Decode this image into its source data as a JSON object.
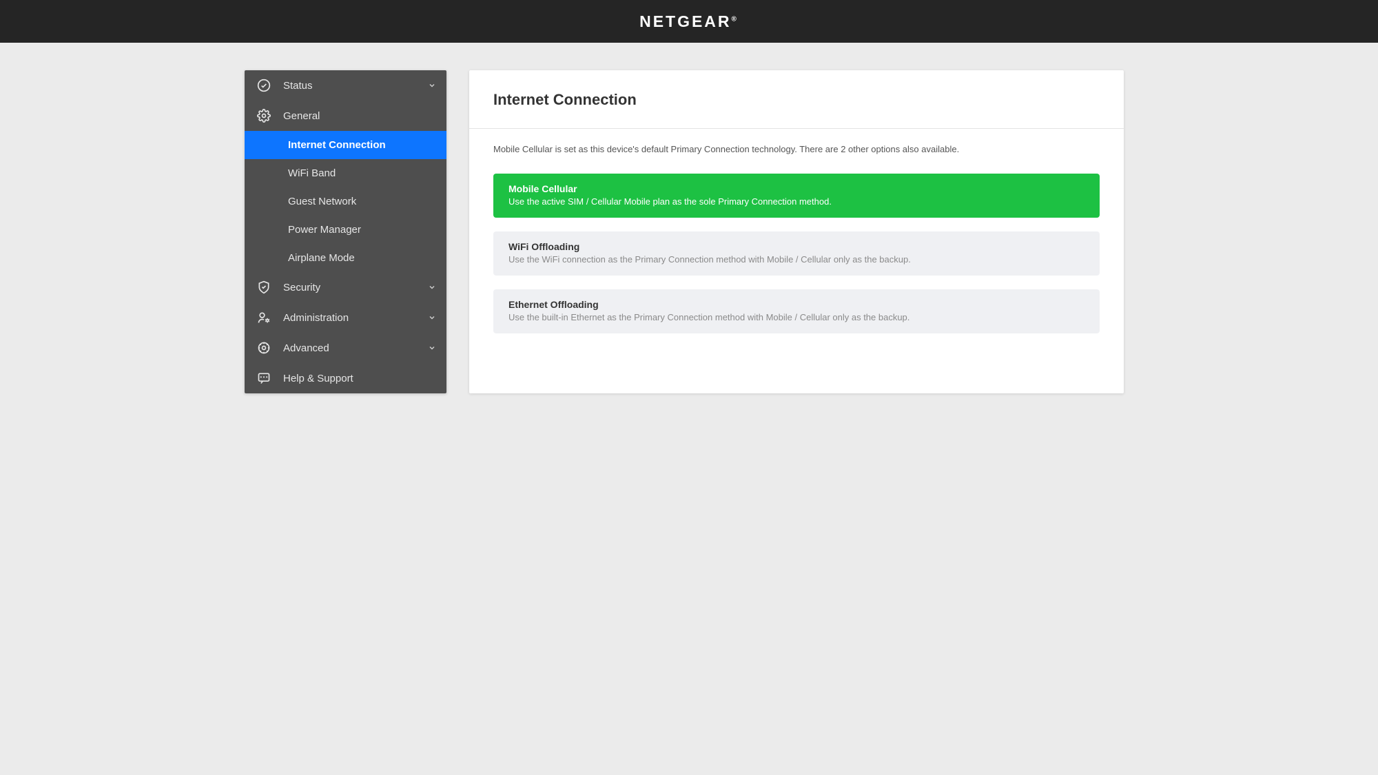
{
  "header": {
    "brand": "NETGEAR"
  },
  "sidebar": {
    "status": {
      "label": "Status"
    },
    "general": {
      "label": "General",
      "sub": {
        "internet_connection": "Internet Connection",
        "wifi_band": "WiFi Band",
        "guest_network": "Guest Network",
        "power_manager": "Power Manager",
        "airplane_mode": "Airplane Mode"
      }
    },
    "security": {
      "label": "Security"
    },
    "administration": {
      "label": "Administration"
    },
    "advanced": {
      "label": "Advanced"
    },
    "help_support": {
      "label": "Help & Support"
    }
  },
  "content": {
    "title": "Internet Connection",
    "description": "Mobile Cellular is set as this device's default Primary Connection technology. There are 2 other options also available.",
    "options": [
      {
        "title": "Mobile Cellular",
        "desc": "Use the active SIM / Cellular Mobile plan as the sole Primary Connection method.",
        "active": true
      },
      {
        "title": "WiFi Offloading",
        "desc": "Use the WiFi connection as the Primary Connection method with Mobile / Cellular only as the backup.",
        "active": false
      },
      {
        "title": "Ethernet Offloading",
        "desc": "Use the built-in Ethernet as the Primary Connection method with Mobile / Cellular only as the backup.",
        "active": false
      }
    ]
  }
}
